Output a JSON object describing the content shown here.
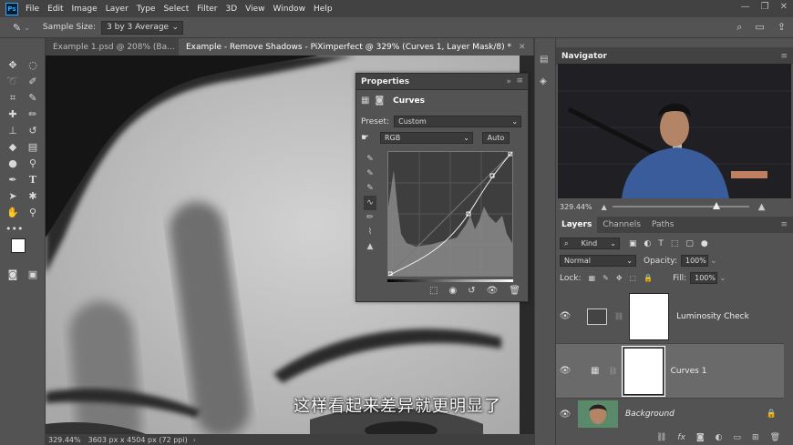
{
  "menubar": {
    "logo": "Ps",
    "items": [
      "File",
      "Edit",
      "Image",
      "Layer",
      "Type",
      "Select",
      "Filter",
      "3D",
      "View",
      "Window",
      "Help"
    ]
  },
  "options": {
    "sample_size_label": "Sample Size:",
    "sample_size_value": "3 by 3 Average"
  },
  "tabs": [
    {
      "label": "Example 1.psd @ 208% (Ba...",
      "active": false
    },
    {
      "label": "Example - Remove Shadows - PiXimperfect @ 329% (Curves 1, Layer Mask/8) *",
      "active": true
    }
  ],
  "subtitle": "这样看起来差异就更明显了",
  "status": {
    "zoom": "329.44%",
    "doc_info": "3603 px x 4504 px (72 ppi)"
  },
  "properties": {
    "title": "Properties",
    "adjustment_name": "Curves",
    "preset_label": "Preset:",
    "preset_value": "Custom",
    "channel_value": "RGB",
    "auto_label": "Auto"
  },
  "navigator": {
    "title": "Navigator",
    "zoom": "329.44%"
  },
  "layers": {
    "tabs": [
      "Layers",
      "Channels",
      "Paths"
    ],
    "filter_kind": "Kind",
    "blend_mode": "Normal",
    "opacity_label": "Opacity:",
    "opacity_value": "100%",
    "lock_label": "Lock:",
    "fill_label": "Fill:",
    "fill_value": "100%",
    "items": [
      {
        "name": "Luminosity Check"
      },
      {
        "name": "Curves 1"
      },
      {
        "name": "Background"
      }
    ]
  },
  "colors": {
    "accent": "#31a8ff",
    "panel_bg": "#535353",
    "header_bg": "#424242"
  }
}
